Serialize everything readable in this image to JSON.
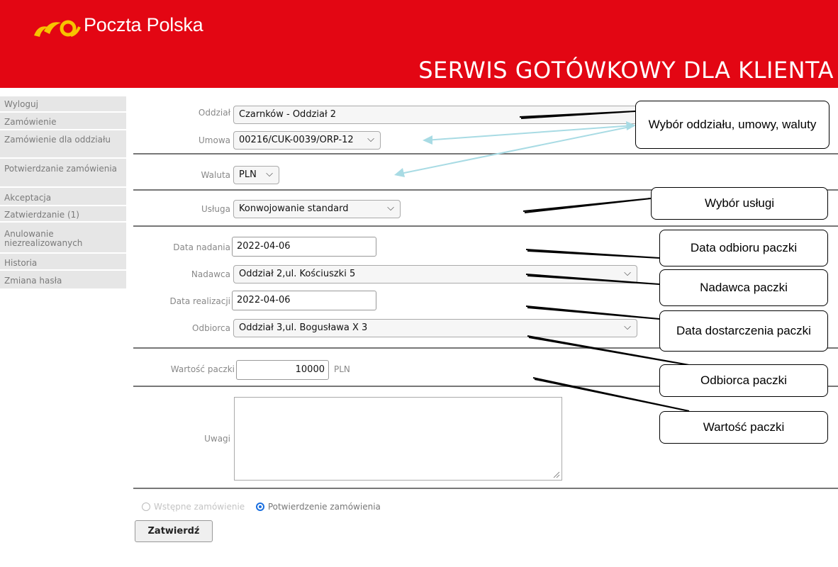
{
  "header": {
    "logo_text": "Poczta Polska",
    "title": "SERWIS GOTÓWKOWY DLA KLIENTA",
    "brand_color": "#e30613",
    "logo_color": "#f7c300"
  },
  "sidebar": {
    "items": [
      {
        "label": "Wyloguj"
      },
      {
        "label": "Zamówienie"
      },
      {
        "label": "Zamówienie dla oddziału"
      },
      {
        "label": "Potwierdzanie zamówienia"
      },
      {
        "label": "Akceptacja"
      },
      {
        "label": "Zatwierdzanie (1)"
      },
      {
        "label": "Anulowanie niezrealizowanych"
      },
      {
        "label": "Historia"
      },
      {
        "label": "Zmiana hasła"
      }
    ]
  },
  "form": {
    "oddzial": {
      "label": "Oddział",
      "value": "Czarnków - Oddział 2"
    },
    "umowa": {
      "label": "Umowa",
      "value": "00216/CUK-0039/ORP-12"
    },
    "waluta": {
      "label": "Waluta",
      "value": "PLN"
    },
    "usluga": {
      "label": "Usługa",
      "value": "Konwojowanie standard"
    },
    "data_nadania": {
      "label": "Data nadania",
      "value": "2022-04-06"
    },
    "nadawca": {
      "label": "Nadawca",
      "value": "Oddział 2,ul. Kościuszki 5"
    },
    "data_realizacji": {
      "label": "Data realizacji",
      "value": "2022-04-06"
    },
    "odbiorca": {
      "label": "Odbiorca",
      "value": "Oddział 3,ul. Bogusława X 3"
    },
    "wartosc": {
      "label": "Wartość paczki",
      "value": "10000",
      "unit": "PLN"
    },
    "uwagi": {
      "label": "Uwagi",
      "value": ""
    },
    "radio_wstepne": {
      "label": "Wstępne zamówienie",
      "selected": false
    },
    "radio_potwierdzenie": {
      "label": "Potwierdzenie zamówienia",
      "selected": true
    },
    "submit_label": "Zatwierdź",
    "chevron": "⌵"
  },
  "annotations": [
    {
      "text": "Wybór oddziału, umowy, waluty"
    },
    {
      "text": "Wybór usługi"
    },
    {
      "text": "Data odbioru paczki"
    },
    {
      "text": "Nadawca paczki"
    },
    {
      "text": "Data dostarczenia paczki"
    },
    {
      "text": "Odbiorca paczki"
    },
    {
      "text": "Wartość paczki"
    }
  ]
}
